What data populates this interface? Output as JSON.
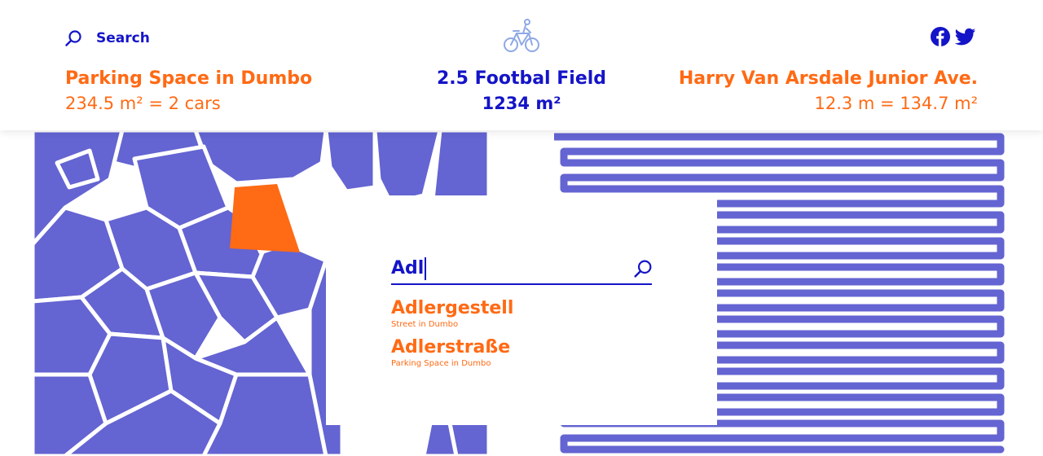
{
  "header": {
    "search_label": "Search",
    "icons": {
      "search": "search-icon",
      "bike": "bicycle-icon",
      "facebook": "facebook-icon",
      "twitter": "twitter-icon"
    }
  },
  "stats": {
    "left": {
      "title": "Parking Space in Dumbo",
      "value": "234.5 m² = 2 cars"
    },
    "middle": {
      "title": "2.5 Footbal Field",
      "value": "1234 m²"
    },
    "right": {
      "title": "Harry Van Arsdale Junior Ave.",
      "value": "12.3 m = 134.7 m²"
    }
  },
  "search_dialog": {
    "input_value": "Adl",
    "suggestions": [
      {
        "title": "Adlergestell",
        "subtitle": "Street in Dumbo"
      },
      {
        "title": "Adlerstraße",
        "subtitle": "Parking Space in Dumbo"
      }
    ]
  },
  "colors": {
    "blue": "#1414c8",
    "orange": "#ff6a14",
    "map_fill": "#6464d2"
  }
}
